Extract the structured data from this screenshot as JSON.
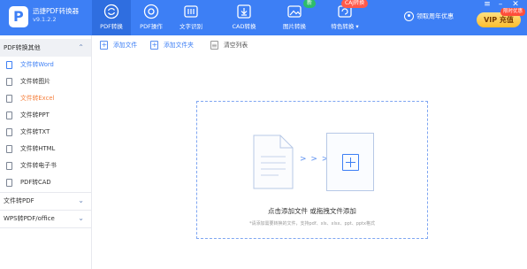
{
  "app": {
    "name": "迅捷PDF转换器",
    "version": "v9.1.2.2",
    "logo_letter": "P"
  },
  "nav_tabs": [
    {
      "label": "PDF转换",
      "icon": "refresh-icon",
      "active": true
    },
    {
      "label": "PDF操作",
      "icon": "target-icon"
    },
    {
      "label": "文字识别",
      "icon": "ocr-icon",
      "badge": ""
    },
    {
      "label": "CAD转换",
      "icon": "download-box-icon"
    },
    {
      "label": "图片转换",
      "icon": "image-icon",
      "badge": "新"
    },
    {
      "label": "特色转换 ▾",
      "icon": "special-convert-icon",
      "badge": "CAJ转换"
    }
  ],
  "badges": {
    "image_new": "新",
    "caj": "CAJ转换"
  },
  "user": {
    "label": "领取周年优惠"
  },
  "vip": {
    "label": "VIP 充值",
    "tag": "限时优惠"
  },
  "window_controls": {
    "menu": "≡",
    "minimize": "–",
    "close": "✕"
  },
  "sidebar": {
    "group1": "PDF转换其他",
    "items": [
      {
        "label": "文件转Word"
      },
      {
        "label": "文件转图片"
      },
      {
        "label": "文件转Excel"
      },
      {
        "label": "文件转PPT"
      },
      {
        "label": "文件转TXT"
      },
      {
        "label": "文件转HTML"
      },
      {
        "label": "文件转电子书"
      },
      {
        "label": "PDF转CAD"
      }
    ],
    "group2": "文件转PDF",
    "group3": "WPS转PDF/office"
  },
  "toolbar": {
    "add_file": "添加文件",
    "add_folder": "添加文件夹",
    "clear_list": "清空列表"
  },
  "dropzone": {
    "main_text": "点击添加文件 或拖拽文件添加",
    "hint": "*请添加需要转换的文件，支持pdf、xls、xlsx、ppt、pptx格式",
    "arrows": "> > >"
  },
  "colors": {
    "brand_blue": "#3d7ff5",
    "active_tab": "#2f6ee0",
    "highlight_orange": "#f5803e",
    "vip_gold": "#fbbd2c"
  }
}
